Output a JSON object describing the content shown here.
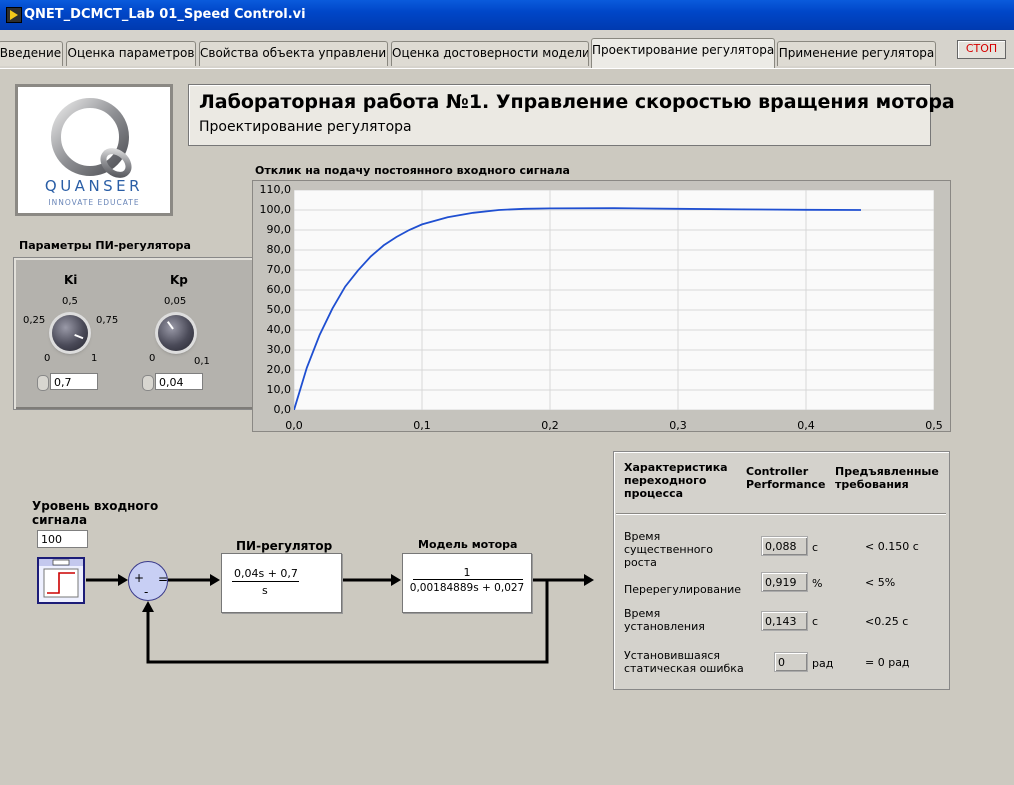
{
  "window": {
    "title": "QNET_DCMCT_Lab 01_Speed Control.vi"
  },
  "tabs": [
    {
      "label": "Введение"
    },
    {
      "label": "Оценка параметров"
    },
    {
      "label": "Свойства объекта управления"
    },
    {
      "label": "Оценка достоверности модели"
    },
    {
      "label": "Проектирование регулятора"
    },
    {
      "label": "Применение регулятора"
    }
  ],
  "stop_label": "СТОП",
  "logo": {
    "brand": "QUANSER",
    "tagline": "INNOVATE EDUCATE",
    "colors": {
      "text": "#2a5ea6"
    }
  },
  "header": {
    "title": "Лабораторная работа №1. Управление скоростью вращения мотора",
    "subtitle": "Проектирование регулятора"
  },
  "pi_panel": {
    "title": "Параметры ПИ-регулятора",
    "ki": {
      "label": "Ki",
      "scale": [
        "0",
        "0,25",
        "0,5",
        "0,75",
        "1"
      ],
      "value": "0,7"
    },
    "kp": {
      "label": "Kp",
      "scale": [
        "0",
        "0,05",
        "0,1"
      ],
      "value": "0,04"
    }
  },
  "chart_data": {
    "type": "line",
    "title": "Отклик на подачу постоянного входного сигнала",
    "xlim": [
      0,
      0.5
    ],
    "ylim": [
      0,
      110
    ],
    "x_ticks": [
      "0,0",
      "0,1",
      "0,2",
      "0,3",
      "0,4",
      "0,5"
    ],
    "y_ticks": [
      "0,0",
      "10,0",
      "20,0",
      "30,0",
      "40,0",
      "50,0",
      "60,0",
      "70,0",
      "80,0",
      "90,0",
      "100,0",
      "110,0"
    ],
    "grid": true,
    "series": [
      {
        "color": "#1f4fd1",
        "x": [
          0,
          0.01,
          0.02,
          0.03,
          0.04,
          0.05,
          0.06,
          0.07,
          0.08,
          0.09,
          0.1,
          0.12,
          0.14,
          0.16,
          0.18,
          0.2,
          0.25,
          0.3,
          0.35,
          0.4,
          0.443
        ],
        "y": [
          0,
          21.1,
          37.5,
          50.7,
          61.7,
          69.8,
          76.8,
          82.3,
          86.5,
          90.0,
          92.8,
          96.4,
          98.6,
          100.0,
          100.6,
          100.8,
          100.9,
          100.6,
          100.3,
          100.1,
          100.0
        ]
      }
    ]
  },
  "input_level": {
    "label": "Уровень входного сигнала",
    "value": "100"
  },
  "diagram": {
    "pi_block": {
      "title": "ПИ-регулятор",
      "numerator": "0,04s + 0,7",
      "denominator": "s"
    },
    "motor_block": {
      "title": "Модель мотора",
      "numerator": "1",
      "denominator": "0,00184889s + 0,027"
    },
    "sum": {
      "plus": "+",
      "minus": "-",
      "eq": "="
    }
  },
  "results": {
    "headers": [
      "Характеристика переходного процесса",
      "Controller Performance",
      "Предъявленные требования"
    ],
    "rows": [
      {
        "name": "Время существенного роста",
        "value": "0,088",
        "unit": "с",
        "requirement": "< 0.150 с"
      },
      {
        "name": "Перерегулирование",
        "value": "0,919",
        "unit": "%",
        "requirement": "< 5%"
      },
      {
        "name": "Время установления",
        "value": "0,143",
        "unit": "с",
        "requirement": "<0.25 с"
      },
      {
        "name": "Установившаяся статическая ошибка",
        "value": "0",
        "unit": "рад",
        "requirement": "= 0 рад"
      }
    ]
  }
}
